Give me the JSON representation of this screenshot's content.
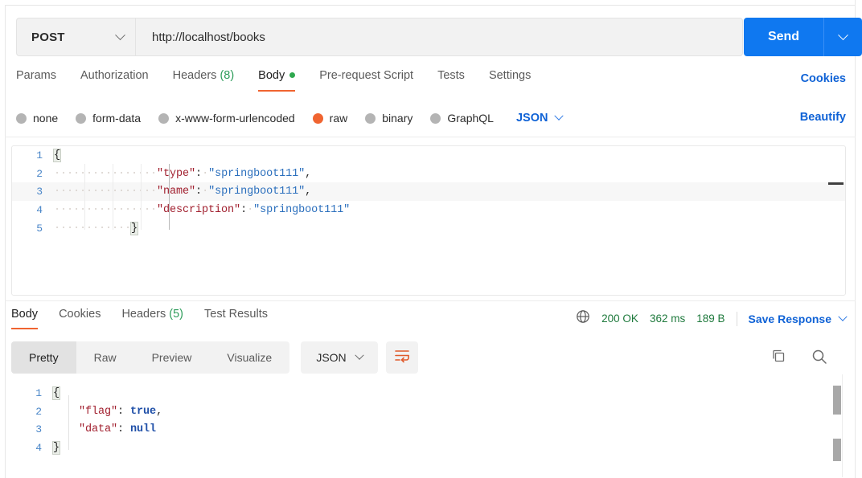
{
  "request": {
    "method": "POST",
    "url": "http://localhost/books",
    "send_label": "Send",
    "tabs": [
      {
        "label": "Params",
        "active": false,
        "count": "",
        "dot": false
      },
      {
        "label": "Authorization",
        "active": false,
        "count": "",
        "dot": false
      },
      {
        "label": "Headers",
        "active": false,
        "count": "(8)",
        "dot": false
      },
      {
        "label": "Body",
        "active": true,
        "count": "",
        "dot": true
      },
      {
        "label": "Pre-request Script",
        "active": false,
        "count": "",
        "dot": false
      },
      {
        "label": "Tests",
        "active": false,
        "count": "",
        "dot": false
      },
      {
        "label": "Settings",
        "active": false,
        "count": "",
        "dot": false
      }
    ],
    "cookies_label": "Cookies",
    "beautify_label": "Beautify",
    "body_types": [
      {
        "label": "none",
        "selected": false
      },
      {
        "label": "form-data",
        "selected": false
      },
      {
        "label": "x-www-form-urlencoded",
        "selected": false
      },
      {
        "label": "raw",
        "selected": true
      },
      {
        "label": "binary",
        "selected": false
      },
      {
        "label": "GraphQL",
        "selected": false
      }
    ],
    "raw_format": "JSON",
    "body_lines": [
      {
        "n": "1",
        "indent": 0,
        "highlight": false,
        "tokens": [
          {
            "t": "{",
            "c": "brace-hl"
          }
        ]
      },
      {
        "n": "2",
        "indent": 4,
        "highlight": false,
        "tokens": [
          {
            "t": "\"type\"",
            "c": "k"
          },
          {
            "t": ":",
            "c": "p"
          },
          {
            "t": "·",
            "c": "ws"
          },
          {
            "t": "\"springboot111\"",
            "c": "s"
          },
          {
            "t": ",",
            "c": "p"
          }
        ]
      },
      {
        "n": "3",
        "indent": 4,
        "highlight": true,
        "tokens": [
          {
            "t": "\"name\"",
            "c": "k"
          },
          {
            "t": ":",
            "c": "p"
          },
          {
            "t": "·",
            "c": "ws"
          },
          {
            "t": "\"springboot111\"",
            "c": "s"
          },
          {
            "t": ",",
            "c": "p"
          }
        ]
      },
      {
        "n": "4",
        "indent": 4,
        "highlight": false,
        "tokens": [
          {
            "t": "\"description\"",
            "c": "k"
          },
          {
            "t": ":",
            "c": "p"
          },
          {
            "t": "·",
            "c": "ws"
          },
          {
            "t": "\"springboot111\"",
            "c": "s"
          }
        ]
      },
      {
        "n": "5",
        "indent": 3,
        "highlight": false,
        "tokens": [
          {
            "t": "}",
            "c": "brace-hl"
          }
        ]
      }
    ]
  },
  "response": {
    "tabs": [
      {
        "label": "Body",
        "active": true,
        "count": ""
      },
      {
        "label": "Cookies",
        "active": false,
        "count": ""
      },
      {
        "label": "Headers",
        "active": false,
        "count": "(5)"
      },
      {
        "label": "Test Results",
        "active": false,
        "count": ""
      }
    ],
    "status": "200 OK",
    "time": "362 ms",
    "size": "189 B",
    "save_label": "Save Response",
    "views": [
      {
        "label": "Pretty",
        "active": true
      },
      {
        "label": "Raw",
        "active": false
      },
      {
        "label": "Preview",
        "active": false
      },
      {
        "label": "Visualize",
        "active": false
      }
    ],
    "format": "JSON",
    "body_lines": [
      {
        "n": "1",
        "indent": 0,
        "tokens": [
          {
            "t": "{",
            "c": "brace-hl"
          }
        ]
      },
      {
        "n": "2",
        "indent": 4,
        "tokens": [
          {
            "t": "\"flag\"",
            "c": "k"
          },
          {
            "t": ": ",
            "c": "p"
          },
          {
            "t": "true",
            "c": "kw"
          },
          {
            "t": ",",
            "c": "p"
          }
        ]
      },
      {
        "n": "3",
        "indent": 4,
        "tokens": [
          {
            "t": "\"data\"",
            "c": "k"
          },
          {
            "t": ": ",
            "c": "p"
          },
          {
            "t": "null",
            "c": "kw"
          }
        ]
      },
      {
        "n": "4",
        "indent": 0,
        "tokens": [
          {
            "t": "}",
            "c": "brace-hl"
          }
        ]
      }
    ]
  },
  "icons": {
    "globe": "globe-icon",
    "copy": "copy-icon",
    "search": "search-icon",
    "wrap": "word-wrap-icon"
  },
  "colors": {
    "accent_blue": "#0f78f0",
    "accent_orange": "#f06430",
    "status_green": "#1f7a3d",
    "link_blue": "#0f62d6"
  }
}
